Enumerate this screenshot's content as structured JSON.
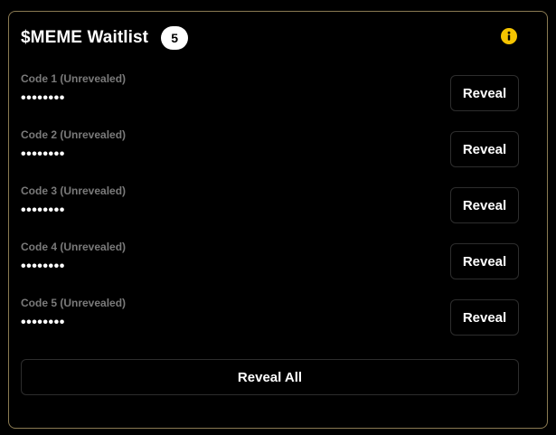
{
  "colors": {
    "background": "#000000",
    "panel_border": "#8a7a52",
    "info_icon": "#f5c400",
    "label_text": "#7a7a7a",
    "button_border": "#2d2d2d"
  },
  "header": {
    "title": "$MEME Waitlist",
    "count": "5",
    "info_icon": "info-icon"
  },
  "codes": [
    {
      "label": "Code 1 (Unrevealed)",
      "value": "••••••••",
      "button": "Reveal"
    },
    {
      "label": "Code 2 (Unrevealed)",
      "value": "••••••••",
      "button": "Reveal"
    },
    {
      "label": "Code 3 (Unrevealed)",
      "value": "••••••••",
      "button": "Reveal"
    },
    {
      "label": "Code 4 (Unrevealed)",
      "value": "••••••••",
      "button": "Reveal"
    },
    {
      "label": "Code 5 (Unrevealed)",
      "value": "••••••••",
      "button": "Reveal"
    }
  ],
  "footer": {
    "reveal_all_label": "Reveal All"
  }
}
